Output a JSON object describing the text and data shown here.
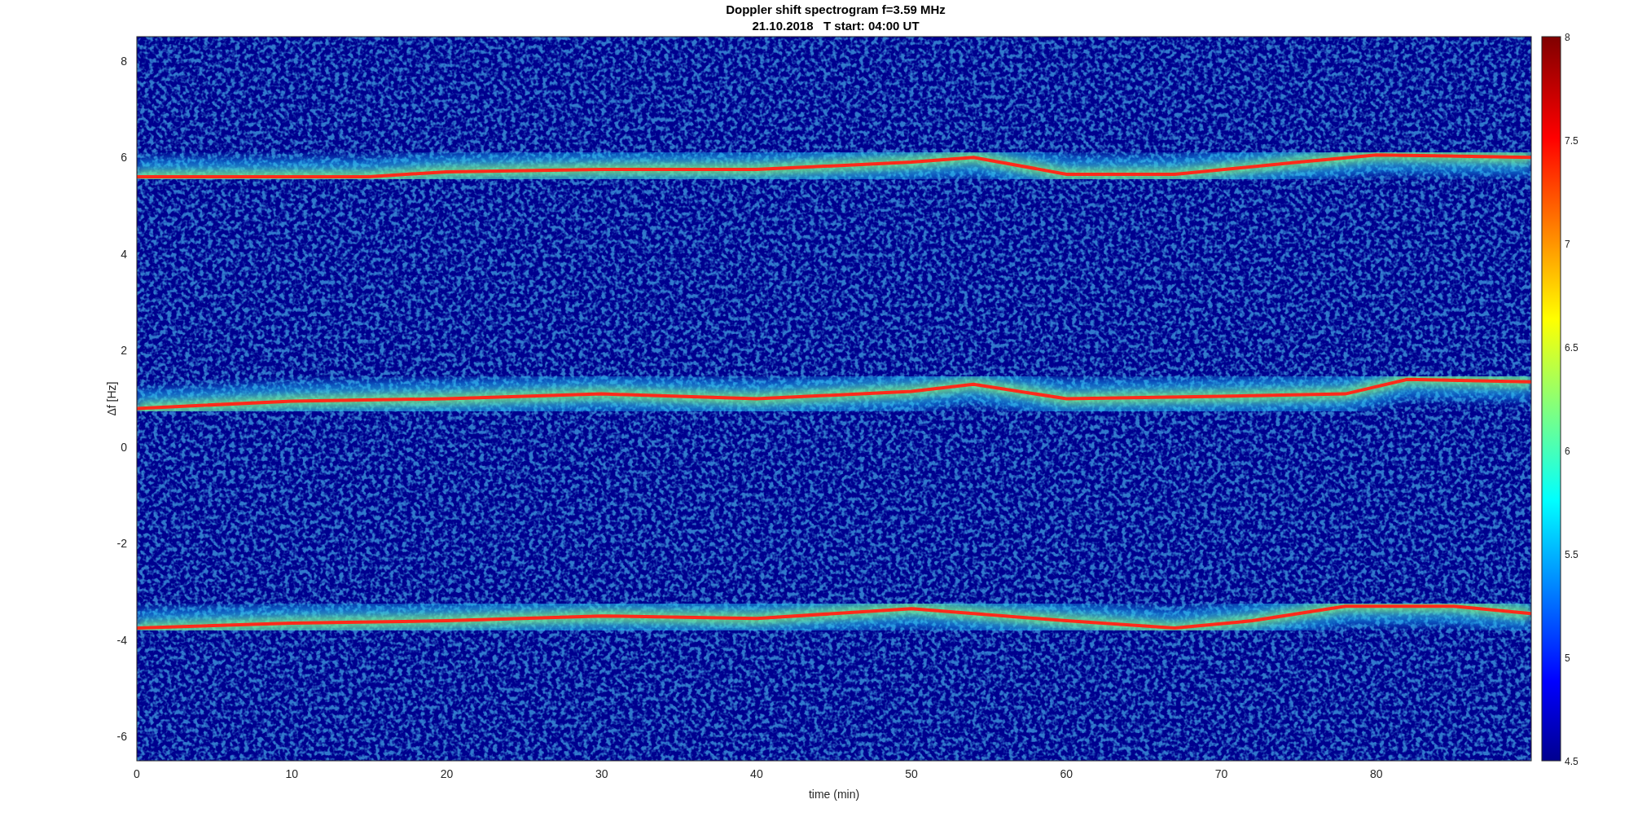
{
  "title": [
    "Doppler shift spectrogram f=3.59 MHz",
    "21.10.2018   T start: 04:00 UT"
  ],
  "plot": {
    "ylabel": "Δf [Hz]",
    "xlabel": "time (min)",
    "yticks": [
      "8",
      "6",
      "4",
      "2",
      "0",
      "-2",
      "-4",
      "-6"
    ],
    "xticks": [
      "0",
      "10",
      "20",
      "30",
      "40",
      "50",
      "60",
      "70",
      "80"
    ]
  },
  "colorbar": {
    "ticks": [
      "8",
      "7.5",
      "7",
      "6.5",
      "6",
      "5.5",
      "5",
      "4.5"
    ]
  }
}
